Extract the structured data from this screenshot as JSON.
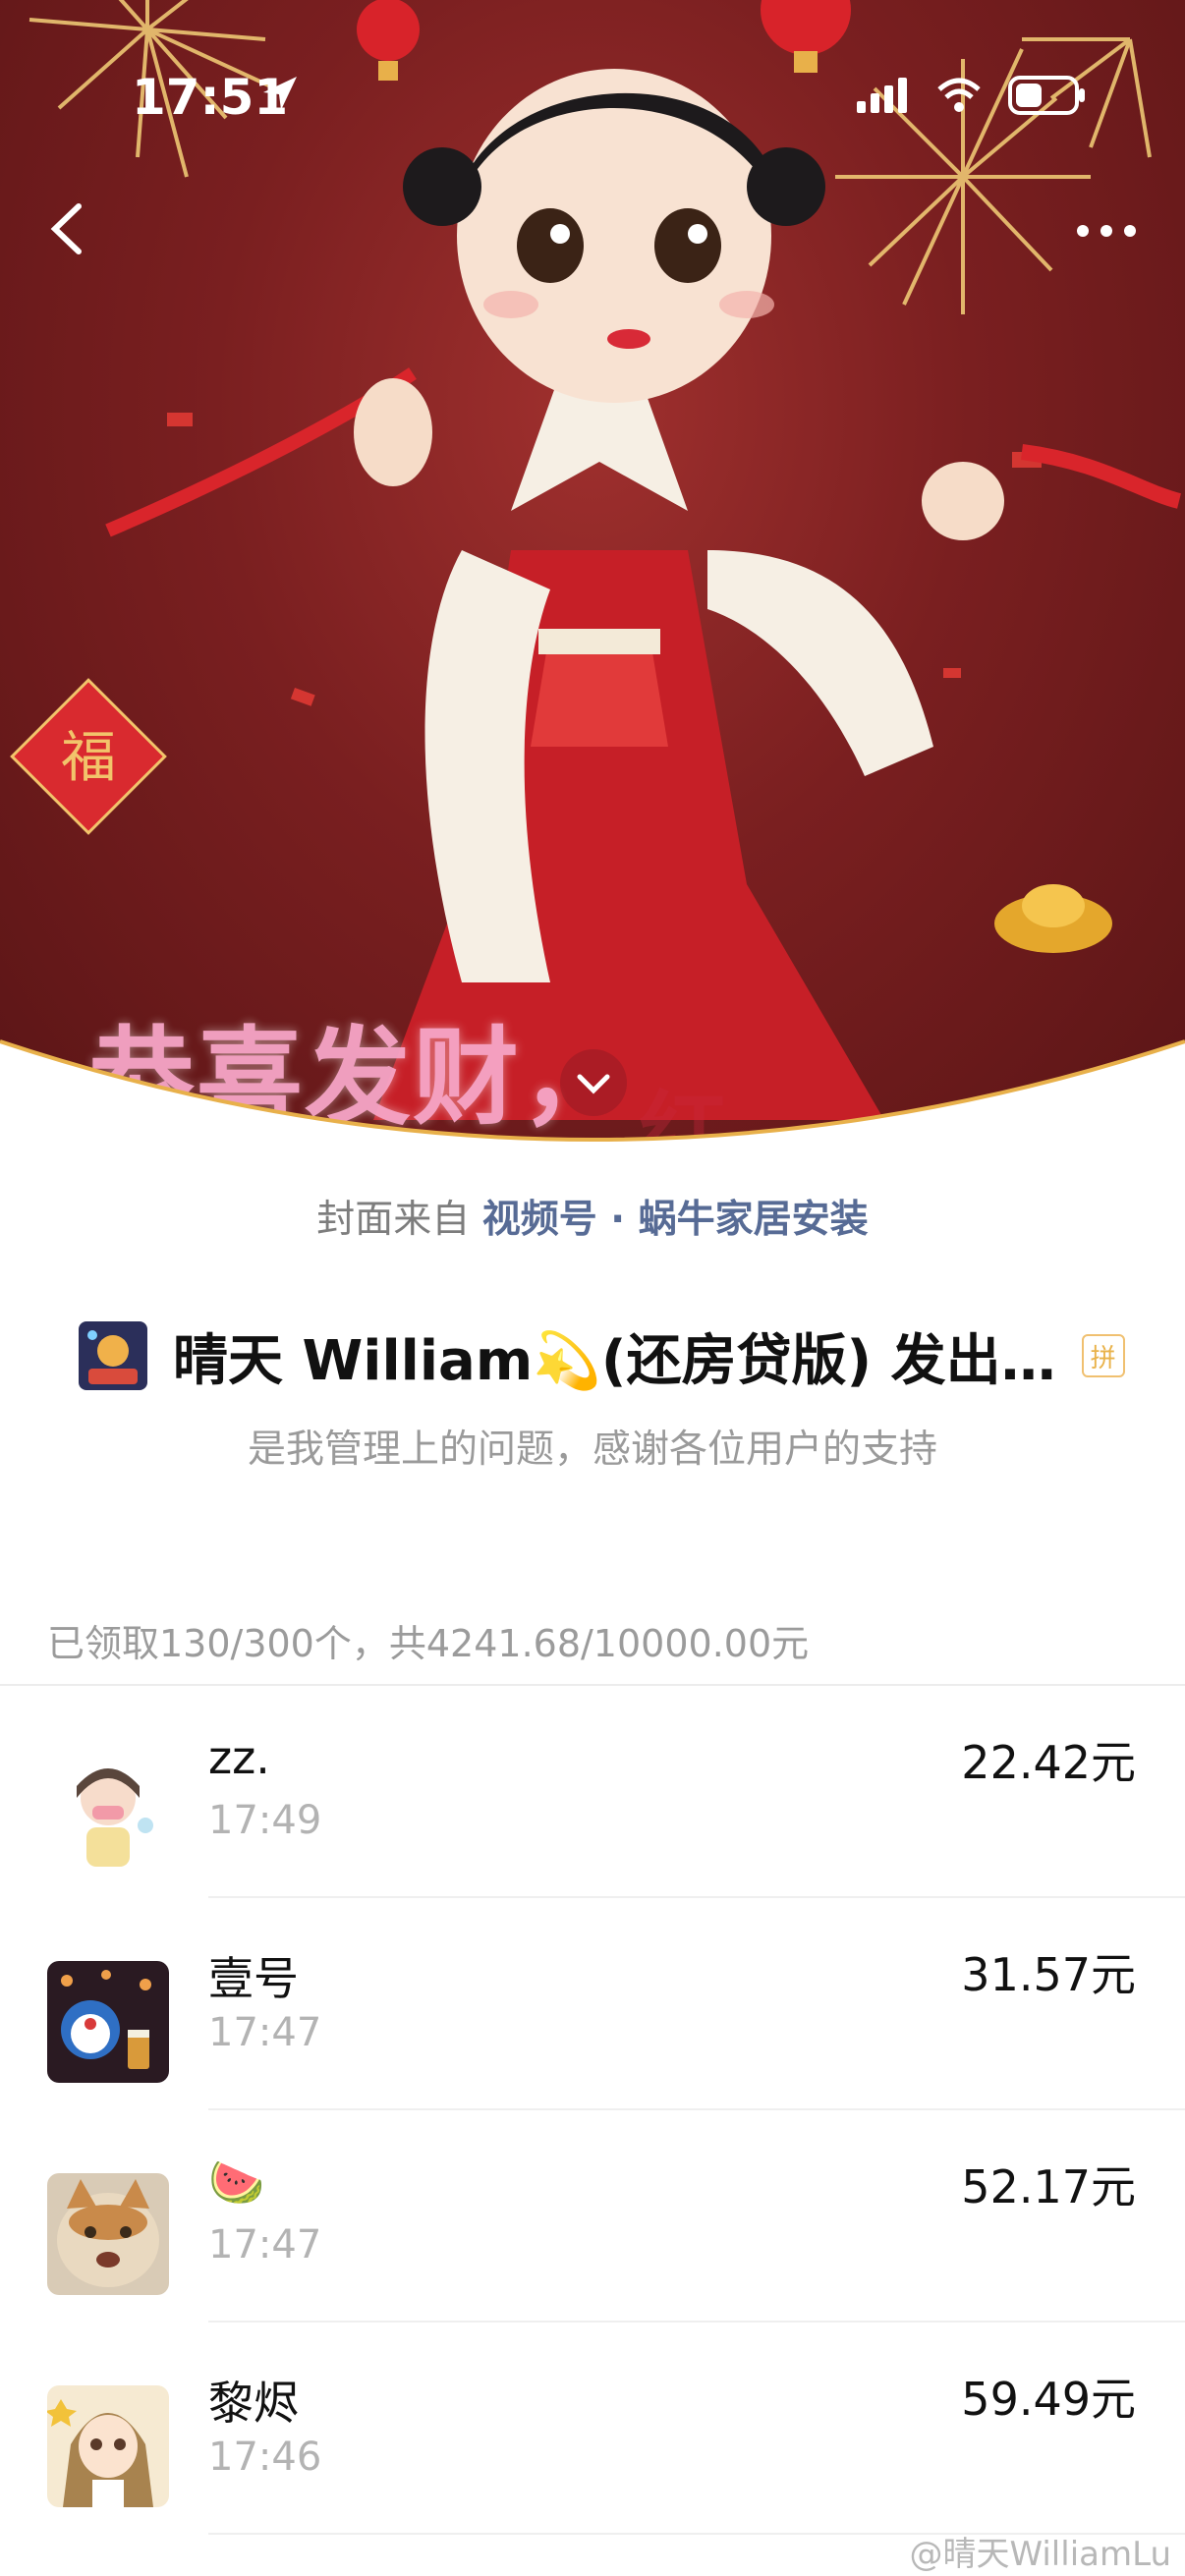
{
  "status_bar": {
    "time": "17:51",
    "location_icon": "location-arrow-icon",
    "signal_icon": "cellular-signal-icon",
    "wifi_icon": "wifi-icon",
    "battery_icon": "battery-icon"
  },
  "nav": {
    "back_icon": "chevron-left-icon",
    "more_icon": "ellipsis-icon",
    "collapse_icon": "chevron-down-icon"
  },
  "cover": {
    "overlay_text": "恭喜发财，",
    "overlay_tail": "红",
    "fu_char": "福"
  },
  "cover_source": {
    "prefix": "封面来自 ",
    "source_link": "视频号 · 蜗牛家居安装"
  },
  "sender": {
    "name": "晴天 William💫(还房贷版) 发出…",
    "pin_badge": "拼",
    "greeting": "是我管理上的问题，感谢各位用户的支持"
  },
  "summary": "已领取130/300个，共4241.68/10000.00元",
  "records": [
    {
      "name": "zz.",
      "time": "17:49",
      "amount": "22.42元"
    },
    {
      "name": "壹号",
      "time": "17:47",
      "amount": "31.57元"
    },
    {
      "name": "🍉",
      "time": "17:47",
      "amount": "52.17元"
    },
    {
      "name": "黎烬",
      "time": "17:46",
      "amount": "59.49元"
    }
  ],
  "watermark": "@晴天WilliamLu",
  "colors": {
    "link": "#576b95",
    "cover_bg": "#7a1f20",
    "gold_wave": "#e8b04a"
  }
}
